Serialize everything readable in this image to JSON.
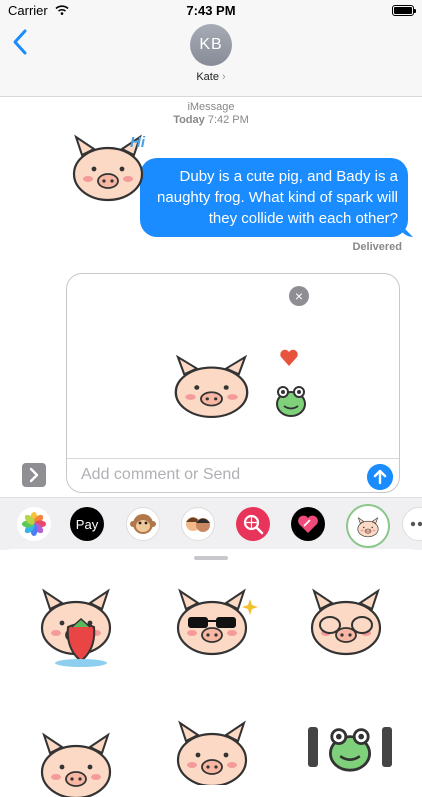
{
  "status": {
    "carrier": "Carrier",
    "time": "7:43 PM"
  },
  "header": {
    "initials": "KB",
    "name": "Kate",
    "chevron": "›"
  },
  "thread": {
    "service": "iMessage",
    "date_day": "Today",
    "date_time": "7:42 PM",
    "message": "Duby is a cute pig, and Bady is a naughty frog. What kind of spark will they collide with each other?",
    "delivered": "Delivered",
    "sticker_text": "Hi"
  },
  "compose": {
    "placeholder": "Add comment or Send"
  },
  "app_strip": {
    "apps": [
      "photos-icon",
      "apple-pay",
      "animoji-icon",
      "memoji-icon",
      "web-search-icon",
      "digital-touch-icon",
      "pig-sticker-app-icon",
      "more-icon"
    ],
    "pay_label": "Pay"
  },
  "colors": {
    "accent": "#1a8cff",
    "pig": "#fbd9c4",
    "frog": "#7fd07a"
  }
}
